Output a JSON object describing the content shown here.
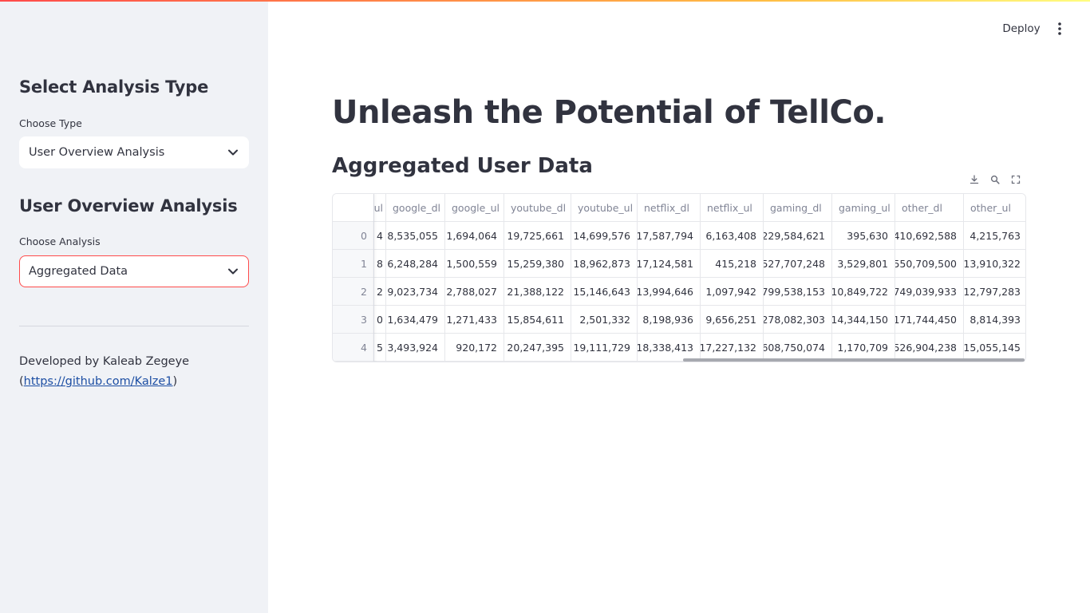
{
  "header": {
    "deploy_label": "Deploy",
    "menu_icon": "kebab-menu-icon"
  },
  "sidebar": {
    "analysis_type_heading": "Select Analysis Type",
    "choose_type_label": "Choose Type",
    "choose_type_value": "User Overview Analysis",
    "section_heading": "User Overview Analysis",
    "choose_analysis_label": "Choose Analysis",
    "choose_analysis_value": "Aggregated Data",
    "developer_text": "Developed by Kaleab Zegeye",
    "developer_link_open": "(",
    "developer_link": "https://github.com/Kalze1",
    "developer_link_close": ")"
  },
  "main": {
    "title": "Unleash the Potential of TellCo.",
    "section_title": "Aggregated User Data",
    "toolbar_icons": [
      "download-icon",
      "search-icon",
      "fullscreen-icon"
    ]
  },
  "table": {
    "partial_header": "ul",
    "columns": [
      "google_dl",
      "google_ul",
      "youtube_dl",
      "youtube_ul",
      "netflix_dl",
      "netflix_ul",
      "gaming_dl",
      "gaming_ul",
      "other_dl",
      "other_ul"
    ],
    "rows": [
      {
        "index": "0",
        "partial": "4",
        "cells": [
          "8,535,055",
          "1,694,064",
          "19,725,661",
          "14,699,576",
          "17,587,794",
          "6,163,408",
          "229,584,621",
          "395,630",
          "410,692,588",
          "4,215,763"
        ]
      },
      {
        "index": "1",
        "partial": "8",
        "cells": [
          "6,248,284",
          "1,500,559",
          "15,259,380",
          "18,962,873",
          "17,124,581",
          "415,218",
          "527,707,248",
          "3,529,801",
          "550,709,500",
          "13,910,322"
        ]
      },
      {
        "index": "2",
        "partial": "2",
        "cells": [
          "9,023,734",
          "2,788,027",
          "21,388,122",
          "15,146,643",
          "13,994,646",
          "1,097,942",
          "799,538,153",
          "10,849,722",
          "749,039,933",
          "12,797,283"
        ]
      },
      {
        "index": "3",
        "partial": "0",
        "cells": [
          "1,634,479",
          "1,271,433",
          "15,854,611",
          "2,501,332",
          "8,198,936",
          "9,656,251",
          "278,082,303",
          "14,344,150",
          "171,744,450",
          "8,814,393"
        ]
      },
      {
        "index": "4",
        "partial": "5",
        "cells": [
          "3,493,924",
          "920,172",
          "20,247,395",
          "19,111,729",
          "18,338,413",
          "17,227,132",
          "608,750,074",
          "1,170,709",
          "526,904,238",
          "15,055,145"
        ]
      }
    ]
  },
  "colors": {
    "accent": "#ff4b4b",
    "sidebar_bg": "#f0f2f6",
    "text": "#31333f",
    "muted": "#808495",
    "link": "#1c4ea3"
  }
}
